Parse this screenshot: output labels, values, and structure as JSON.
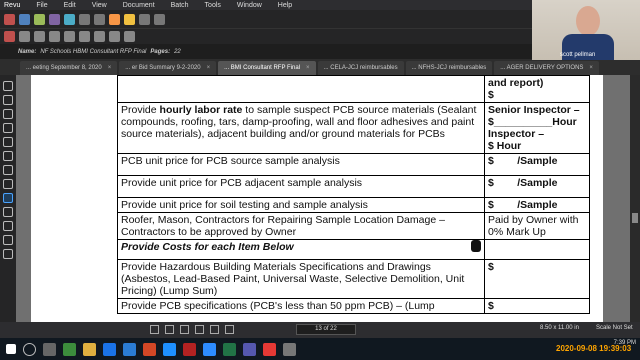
{
  "menu": {
    "app": "Revu",
    "items": [
      "File",
      "Edit",
      "View",
      "Document",
      "Batch",
      "Tools",
      "Window",
      "Help"
    ]
  },
  "docbar": {
    "name_label": "Name:",
    "name_value": "NF Schools HBMI Consultant RFP Final",
    "pages_label": "Pages:",
    "pages_value": "22"
  },
  "tabs": [
    {
      "label": "... eeting September 8, 2020",
      "active": false
    },
    {
      "label": "... er Bid Summary 9-2-2020",
      "active": false
    },
    {
      "label": "... BMI Consultant RFP Final",
      "active": true
    },
    {
      "label": "... CELA-JCJ reimbursables",
      "active": false
    },
    {
      "label": "... NFHS-JCJ reimbursables",
      "active": false
    },
    {
      "label": "... AGER DELIVERY OPTIONS",
      "active": false
    }
  ],
  "table": {
    "rows": [
      {
        "c1": "",
        "c2": "and report)\n$"
      },
      {
        "c1_pre": "Provide ",
        "c1_bold": "hourly labor rate",
        "c1_post": " to sample suspect PCB source materials (Sealant compounds, roofing, tars, damp-proofing, wall and floor adhesives and paint source materials), adjacent building and/or ground materials for PCBs",
        "c2": "Senior Inspector –\n$__________Hour\nInspector –\n$          Hour"
      },
      {
        "c1": "PCB unit price for PCB source sample analysis",
        "c2": "$        /Sample"
      },
      {
        "c1": "Provide unit price for PCB adjacent sample analysis",
        "c2": "$        /Sample"
      },
      {
        "c1": "Provide unit price for soil testing and sample analysis",
        "c2": "$        /Sample"
      },
      {
        "c1": "Roofer, Mason, Contractors for Repairing Sample Location Damage – Contractors to be approved by Owner",
        "c2": "Paid by Owner with 0% Mark Up"
      },
      {
        "c1": "Provide Costs for each Item Below",
        "c2": ""
      },
      {
        "c1": "Provide Hazardous Building Materials Specifications and Drawings (Asbestos, Lead-Based Paint, Universal Waste, Selective Demolition, Unit Pricing) (Lump Sum)",
        "c2": "$"
      },
      {
        "c1": "Provide PCB specifications (PCB's less than 50 ppm PCB) – (Lump",
        "c2": "$"
      }
    ]
  },
  "status": {
    "page": "13 of 22",
    "dims": "8.50 x 11.00 in",
    "scale": "Scale Not Set"
  },
  "webcam": {
    "name": "scott pellman"
  },
  "clock": {
    "time": "7:39 PM"
  },
  "timestamp": "2020-09-08 19:39:03"
}
